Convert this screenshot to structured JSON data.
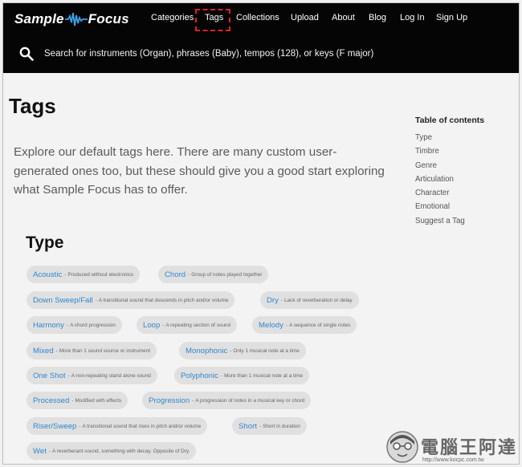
{
  "brand": {
    "logo_left": "Sample",
    "logo_right": "Focus"
  },
  "nav": {
    "items": [
      {
        "label": "Categories"
      },
      {
        "label": "Tags"
      },
      {
        "label": "Collections"
      },
      {
        "label": "Upload"
      },
      {
        "label": "About"
      },
      {
        "label": "Blog"
      },
      {
        "label": "Log In"
      },
      {
        "label": "Sign Up"
      }
    ],
    "highlighted": "Tags",
    "highlight_color": "#e0202a"
  },
  "search": {
    "icon": "search-icon",
    "placeholder": "Search for instruments (Organ),  phrases (Baby),  tempos (128),  or keys (F major)"
  },
  "page": {
    "title": "Tags",
    "intro": "Explore our default tags here. There are many custom user-generated ones too, but these should give you a good start exploring what Sample Focus has to offer."
  },
  "toc": {
    "title": "Table of contents",
    "items": [
      "Type",
      "Timbre",
      "Genre",
      "Articulation",
      "Character",
      "Emotional",
      "Suggest a Tag"
    ]
  },
  "type_section": {
    "title": "Type",
    "tags": [
      {
        "name": "Acoustic",
        "desc": "Produced without electronics"
      },
      {
        "name": "Chord",
        "desc": "Group of notes played together"
      },
      {
        "name": "Down Sweep/Fall",
        "desc": "A transitional sound that descends in pitch and/or volume"
      },
      {
        "name": "Dry",
        "desc": "Lack of reverberation or delay"
      },
      {
        "name": "Harmony",
        "desc": "A chord progression"
      },
      {
        "name": "Loop",
        "desc": "A repeating section of sound"
      },
      {
        "name": "Melody",
        "desc": "A sequence of single notes"
      },
      {
        "name": "Mixed",
        "desc": "More than 1 sound source or instrument"
      },
      {
        "name": "Monophonic",
        "desc": "Only 1 musical note at a time"
      },
      {
        "name": "One Shot",
        "desc": "A non-repeating stand alone sound"
      },
      {
        "name": "Polyphonic",
        "desc": "More than 1 musical note at a time"
      },
      {
        "name": "Processed",
        "desc": "Modified with effects"
      },
      {
        "name": "Progression",
        "desc": "A progression of notes in a musical key or chord"
      },
      {
        "name": "Riser/Sweep",
        "desc": "A transitional sound that rises in pitch and/or volume"
      },
      {
        "name": "Short",
        "desc": "Short in duration"
      },
      {
        "name": "Wet",
        "desc": "A reverberant sound, something with decay. Opposite of Dry."
      }
    ]
  },
  "watermark": {
    "title": "電腦王阿達",
    "url": "http://www.kocpc.com.tw"
  },
  "colors": {
    "header_bg": "#050505",
    "tag_bg": "#e0e0e0",
    "tag_link": "#2f87cf",
    "page_bg": "#f3f3f3"
  }
}
